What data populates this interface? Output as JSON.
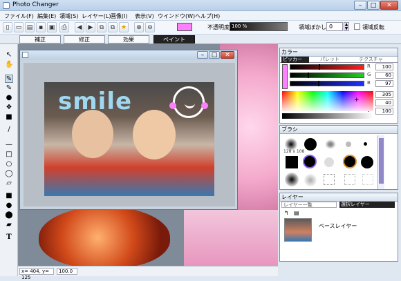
{
  "window": {
    "title": "Photo Changer"
  },
  "menu": [
    "ファイル(F)",
    "編集(E)",
    "領域(S)",
    "レイヤー(L)",
    "画像(I)",
    "表示(V)",
    "ウインドウ(W)",
    "ヘルプ(H)"
  ],
  "toolbar": {
    "opacity_label": "不透明度",
    "opacity_value": "100 %",
    "opacity_fraction": 1.0,
    "blur_label": "領域ぼかし",
    "blur_value": "0",
    "invert_label": "領域反転"
  },
  "mode_tabs": [
    "補正",
    "修正",
    "効果",
    "ペイント"
  ],
  "mode_tabs_active": 3,
  "document": {
    "caption": "smile"
  },
  "status": {
    "coords": "x= 404, y= 125",
    "zoom": "100.0"
  },
  "color_panel": {
    "title": "カラー",
    "tabs": [
      "ピッカー",
      "パレット",
      "テクスチャ"
    ],
    "sliders": [
      {
        "label": "R",
        "value": "100",
        "color": "#ff2020",
        "level": 0.39
      },
      {
        "label": "G",
        "value": "60",
        "color": "#20d020",
        "level": 0.24
      },
      {
        "label": "B",
        "value": "97",
        "color": "#2030ff",
        "level": 0.38
      },
      {
        "label": "H",
        "value": "305",
        "color": "#999999",
        "level": 0.85
      },
      {
        "label": "S",
        "value": "40",
        "color": "#999999",
        "level": 0.4
      },
      {
        "label": "V",
        "value": "100",
        "color": "#999999",
        "level": 1.0
      }
    ],
    "current_color": "#ff80ff"
  },
  "brush_panel": {
    "title": "ブラシ",
    "size_label": "128 x 108"
  },
  "layer_panel": {
    "title": "レイヤー",
    "tabs": [
      "レイヤー一覧",
      "選択レイヤー"
    ],
    "items": [
      "ベースレイヤー"
    ]
  },
  "colors": {
    "accent_pink": "#ff80ff",
    "workspace": "#7f8b98"
  }
}
